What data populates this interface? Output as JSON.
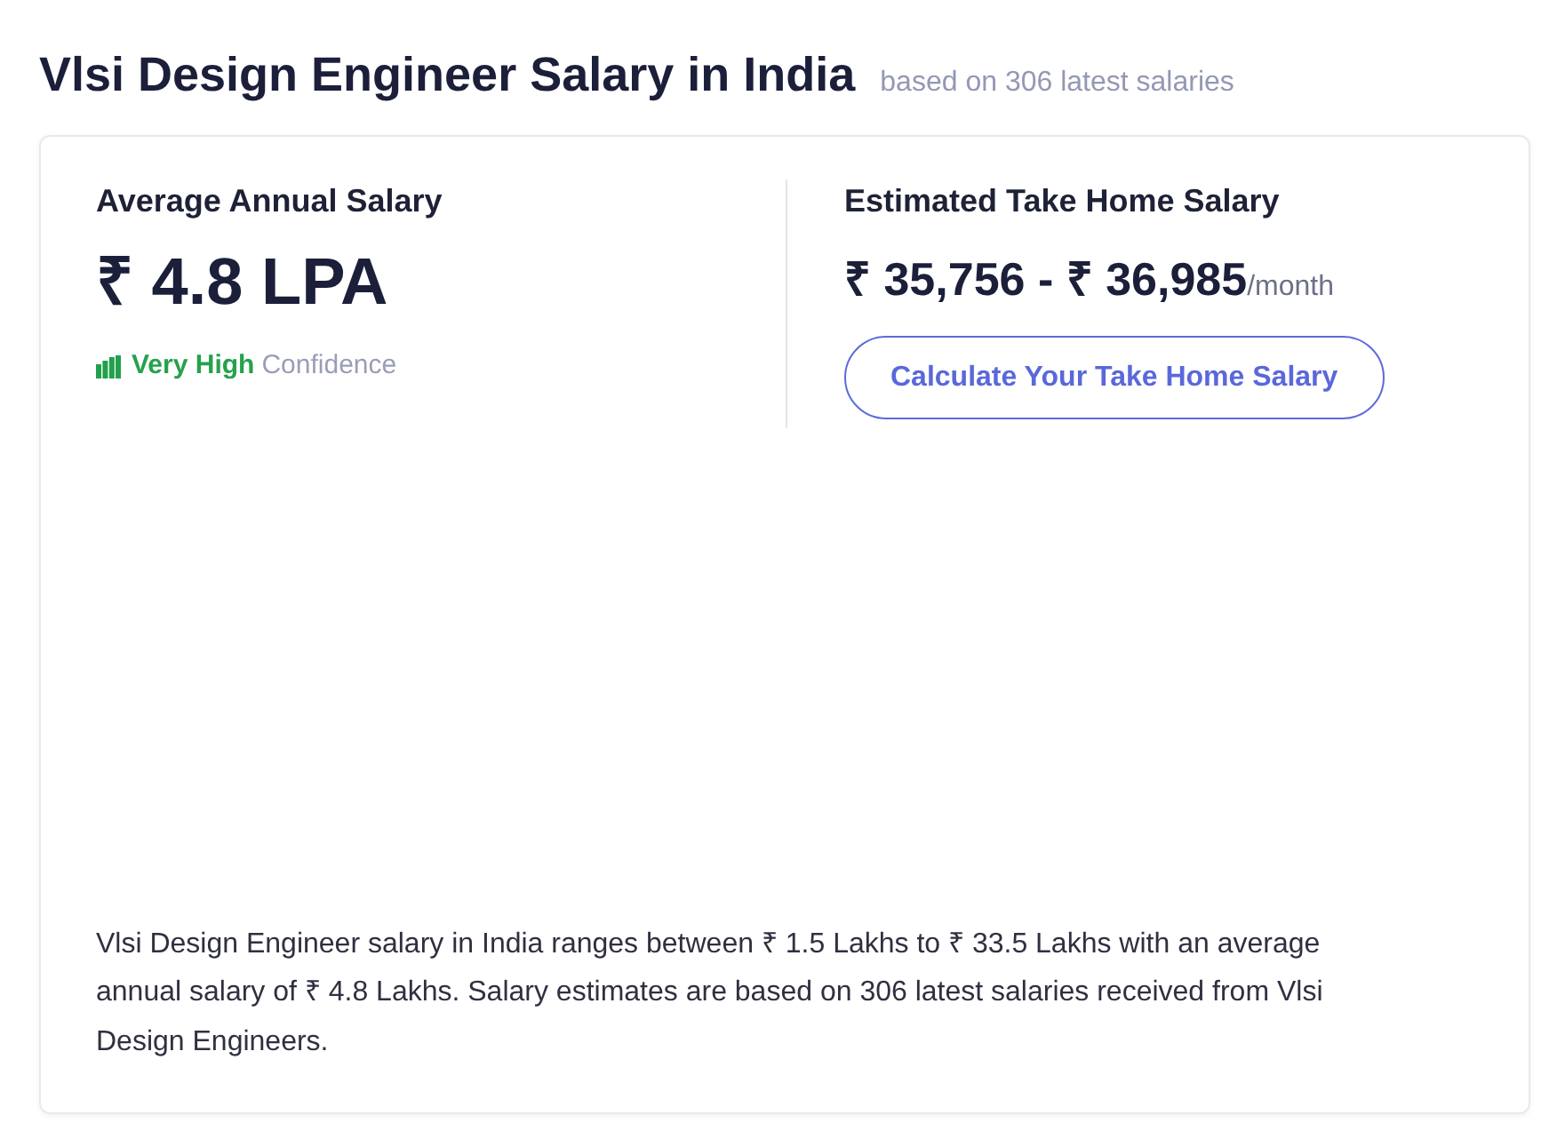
{
  "header": {
    "title": "Vlsi Design Engineer Salary in India",
    "subtitle": "based on 306 latest salaries"
  },
  "average_salary": {
    "label": "Average Annual Salary",
    "value": "₹ 4.8 LPA",
    "confidence": {
      "rating": "Very High",
      "label": "Confidence"
    }
  },
  "take_home": {
    "label": "Estimated Take Home Salary",
    "range": "₹ 35,756 - ₹ 36,985",
    "unit": "/month",
    "button": "Calculate Your Take Home Salary"
  },
  "summary": "Vlsi Design Engineer salary in India ranges between ₹ 1.5 Lakhs to ₹ 33.5 Lakhs with an average annual salary of ₹ 4.8 Lakhs. Salary estimates are based on 306 latest salaries received from Vlsi Design Engineers."
}
